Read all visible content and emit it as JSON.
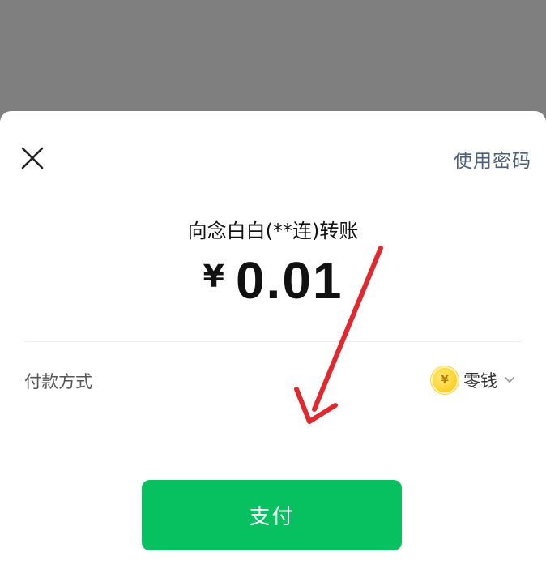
{
  "header": {
    "close_icon": "close-icon",
    "use_password_label": "使用密码"
  },
  "payment": {
    "payee_text": "向念白白(**连)转账",
    "currency_symbol": "¥",
    "amount": "0.01"
  },
  "pay_method": {
    "label": "付款方式",
    "coin_icon": "coin-icon",
    "coin_glyph": "¥",
    "selected": "零钱",
    "chevron_icon": "chevron-down-icon"
  },
  "actions": {
    "pay_label": "支付"
  },
  "colors": {
    "overlay": "#7f7f7f",
    "sheet": "#ffffff",
    "primary_green": "#07c160",
    "link_blue": "#4b5f7a",
    "annotation_red": "#e0282e"
  }
}
